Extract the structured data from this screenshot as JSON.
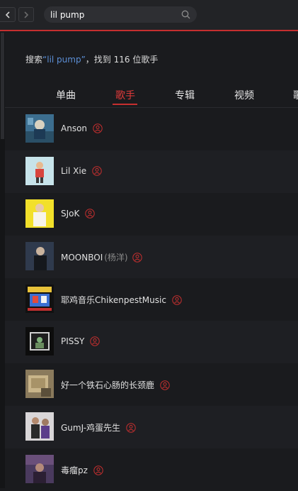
{
  "search": {
    "value": "lil pump"
  },
  "summary": {
    "prefix": "搜索",
    "query": "“lil pump”",
    "suffix": "，找到 116 位歌手"
  },
  "tabs": [
    {
      "label": "单曲"
    },
    {
      "label": "歌手"
    },
    {
      "label": "专辑"
    },
    {
      "label": "视频"
    },
    {
      "label": "歌"
    }
  ],
  "active_tab": "歌手",
  "artists": [
    {
      "name": "Anson",
      "alias": ""
    },
    {
      "name": "Lil Xie",
      "alias": ""
    },
    {
      "name": "SJoK",
      "alias": ""
    },
    {
      "name": "MOONBOI",
      "alias": "(杨洋)"
    },
    {
      "name": "耶鸡音乐ChikenpestMusic",
      "alias": ""
    },
    {
      "name": "PISSY",
      "alias": ""
    },
    {
      "name": "好一个铁石心肠的长颈鹿",
      "alias": ""
    },
    {
      "name": "GumJ-鸡蛋先生",
      "alias": ""
    },
    {
      "name": "毒瘤pz",
      "alias": ""
    }
  ],
  "colors": {
    "accent": "#c62f2f",
    "link": "#5c8fd6"
  }
}
